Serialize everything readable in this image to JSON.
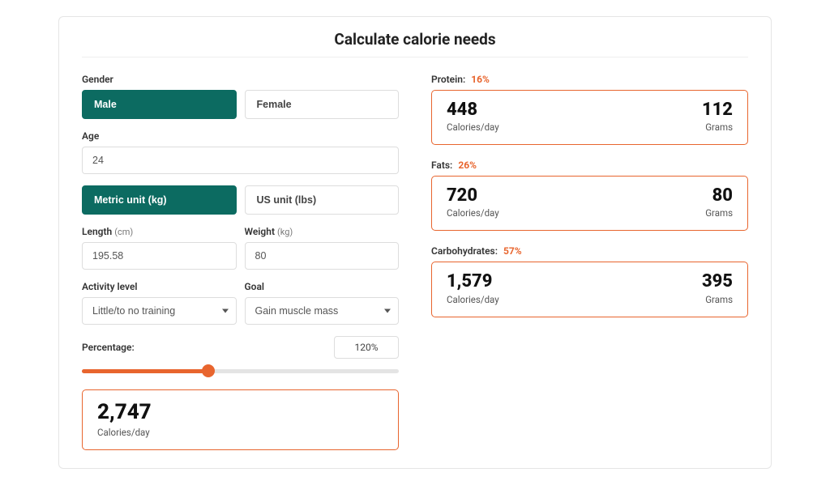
{
  "title": "Calculate calorie needs",
  "form": {
    "gender_label": "Gender",
    "gender_male": "Male",
    "gender_female": "Female",
    "age_label": "Age",
    "age_value": "24",
    "unit_metric": "Metric unit (kg)",
    "unit_us": "US unit (lbs)",
    "length_label": "Length",
    "length_unit": "(cm)",
    "length_value": "195.58",
    "weight_label": "Weight",
    "weight_unit": "(kg)",
    "weight_value": "80",
    "activity_label": "Activity level",
    "activity_value": "Little/to no training",
    "goal_label": "Goal",
    "goal_value": "Gain muscle mass",
    "percentage_label": "Percentage:",
    "percentage_display": "120%",
    "slider_fill_pct": 40
  },
  "result": {
    "value": "2,747",
    "unit": "Calories/day"
  },
  "macros": {
    "protein": {
      "label": "Protein:",
      "pct": "16%",
      "cal": "448",
      "cal_unit": "Calories/day",
      "grams": "112",
      "grams_unit": "Grams"
    },
    "fats": {
      "label": "Fats:",
      "pct": "26%",
      "cal": "720",
      "cal_unit": "Calories/day",
      "grams": "80",
      "grams_unit": "Grams"
    },
    "carbs": {
      "label": "Carbohydrates:",
      "pct": "57%",
      "cal": "1,579",
      "cal_unit": "Calories/day",
      "grams": "395",
      "grams_unit": "Grams"
    }
  }
}
